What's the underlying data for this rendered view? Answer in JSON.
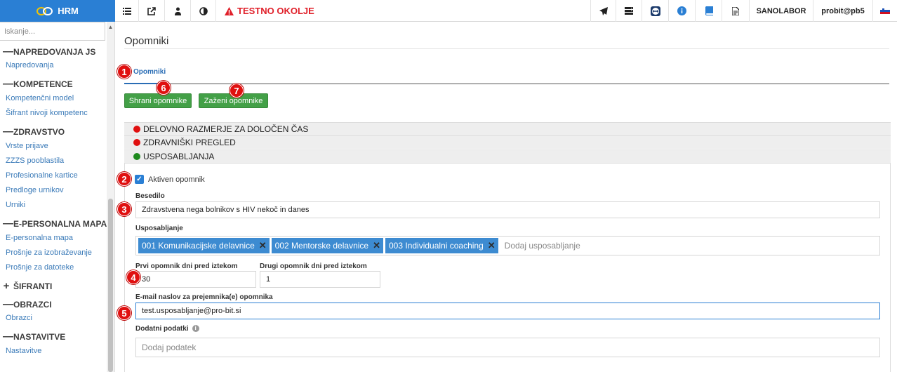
{
  "app": {
    "logo_text": "HRM"
  },
  "topbar": {
    "environment_label": "TESTNO OKOLJE",
    "company": "SANOLABOR",
    "user": "probit@pb5"
  },
  "sidebar": {
    "search_placeholder": "Iskanje...",
    "sections": [
      {
        "title": "NAPREDOVANJA JS",
        "symbol": "—",
        "items": [
          "Napredovanja"
        ]
      },
      {
        "title": "KOMPETENCE",
        "symbol": "—",
        "items": [
          "Kompetenčni model",
          "Šifrant nivoji kompetenc"
        ]
      },
      {
        "title": "ZDRAVSTVO",
        "symbol": "—",
        "items": [
          "Vrste prijave",
          "ZZZS pooblastila",
          "Profesionalne kartice",
          "Predloge urnikov",
          "Urniki"
        ]
      },
      {
        "title": "E-PERSONALNA MAPA",
        "symbol": "—",
        "items": [
          "E-personalna mapa",
          "Prošnje za izobraževanje",
          "Prošnje za datoteke"
        ]
      },
      {
        "title": "ŠIFRANTI",
        "symbol": "+",
        "items": []
      },
      {
        "title": "OBRAZCI",
        "symbol": "—",
        "items": [
          "Obrazci"
        ]
      },
      {
        "title": "NASTAVITVE",
        "symbol": "—",
        "items": [
          "Nastavitve"
        ]
      }
    ]
  },
  "main": {
    "title": "Opomniki",
    "tab_label": "Opomniki",
    "buttons": {
      "save": "Shrani opomnike",
      "run": "Zaženi opomnike"
    },
    "accordion": [
      {
        "label": "DELOVNO RAZMERJE ZA DOLOČEN ČAS",
        "status_color": "#e01010"
      },
      {
        "label": "ZDRAVNIŠKI PREGLED",
        "status_color": "#e01010"
      },
      {
        "label": "USPOSABLJANJA",
        "status_color": "#1e8a1e"
      }
    ],
    "form": {
      "active_label": "Aktiven opomnik",
      "active_checked": true,
      "text_label": "Besedilo",
      "text_value": "Zdravstvena nega bolnikov s HIV nekoč in danes",
      "training_label": "Usposabljanje",
      "training_tags": [
        "001 Komunikacijske delavnice",
        "002 Mentorske delavnice",
        "003 Individualni coaching"
      ],
      "training_placeholder": "Dodaj usposabljanje",
      "first_label": "Prvi opomnik dni pred iztekom",
      "first_value": "30",
      "second_label": "Drugi opomnik dni pred iztekom",
      "second_value": "1",
      "email_label": "E-mail naslov za prejemnika(e) opomnika",
      "email_value": "test.usposabljanje@pro-bit.si",
      "extra_label": "Dodatni podatki",
      "extra_placeholder": "Dodaj podatek"
    }
  },
  "annotations": [
    "1",
    "2",
    "3",
    "4",
    "5",
    "6",
    "7"
  ]
}
